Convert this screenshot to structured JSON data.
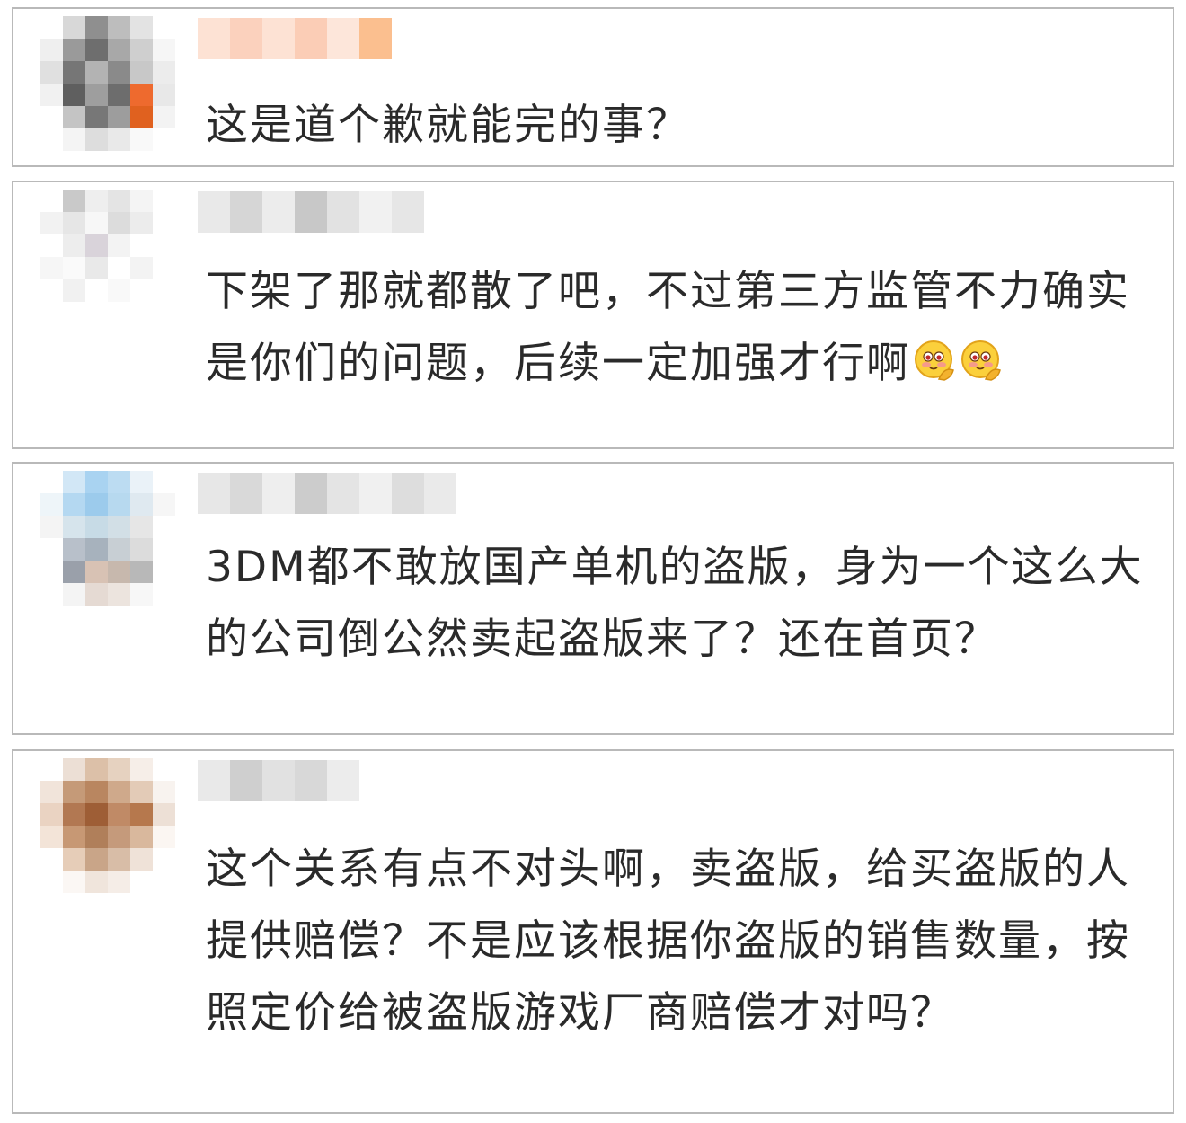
{
  "comments": [
    {
      "text": "这是道个歉就能完的事？",
      "avatar_colors": [
        "#ffffff",
        "#d8d8d8",
        "#8f8f8f",
        "#bdbdbd",
        "#e3e3e3",
        "#ffffff",
        "#efefef",
        "#9a9a9a",
        "#6e6e6e",
        "#a8a8a8",
        "#cfcfcf",
        "#f6f6f6",
        "#e0e0e0",
        "#767676",
        "#b3b3b3",
        "#8a8a8a",
        "#c8c8c8",
        "#ececec",
        "#f1f1f1",
        "#5f5f5f",
        "#9e9e9e",
        "#6d6d6d",
        "#ee6a2e",
        "#e8e8e8",
        "#ffffff",
        "#c4c4c4",
        "#777777",
        "#9d9d9d",
        "#e0611f",
        "#f3f3f3",
        "#ffffff",
        "#f4f4f4",
        "#dddddd",
        "#e9e9e9",
        "#f9f9f9",
        "#ffffff"
      ],
      "name_colors": [
        "#fde2d4",
        "#fbd1bd",
        "#fde2d4",
        "#fbcdb6",
        "#fde6da",
        "#fbbf8f"
      ]
    },
    {
      "text": "下架了那就都散了吧，不过第三方监管不力确实是你们的问题，后续一定加强才行啊",
      "emojis": [
        "hand-on-chin-blushing-emoji",
        "hand-on-chin-blushing-emoji"
      ],
      "avatar_colors": [
        "#ffffff",
        "#c9c9c9",
        "#eeeeee",
        "#e4e4e4",
        "#f4f4f4",
        "#ffffff",
        "#f2f2f2",
        "#e6e6e6",
        "#f7f7f7",
        "#dcdcdc",
        "#ececec",
        "#ffffff",
        "#ffffff",
        "#ededed",
        "#d9d3da",
        "#f3f3f3",
        "#ffffff",
        "#ffffff",
        "#f6f6f6",
        "#fafafa",
        "#e9e9e9",
        "#ffffff",
        "#f3f3f3",
        "#ffffff",
        "#ffffff",
        "#f1f1f1",
        "#ffffff",
        "#f9f9f9",
        "#ffffff",
        "#ffffff",
        "#ffffff",
        "#ffffff",
        "#ffffff",
        "#ffffff",
        "#ffffff",
        "#ffffff"
      ],
      "name_colors": [
        "#e9e9e9",
        "#d6d6d6",
        "#ececec",
        "#c8c8c8",
        "#e2e2e2",
        "#f1f1f1",
        "#e6e6e6"
      ]
    },
    {
      "text": "3DM都不敢放国产单机的盗版，身为一个这么大的公司倒公然卖起盗版来了？还在首页？",
      "avatar_colors": [
        "#ffffff",
        "#d2e7f6",
        "#a9d3f1",
        "#bcdcf2",
        "#eaf2f8",
        "#ffffff",
        "#eef5f9",
        "#b4d8f1",
        "#9ccbec",
        "#b7d9ef",
        "#dfe9f0",
        "#f6f6f6",
        "#f4f4f4",
        "#d6e4ec",
        "#c7dbe6",
        "#d2dfe6",
        "#e6e6e6",
        "#ffffff",
        "#ffffff",
        "#b8c0ca",
        "#a7b2bd",
        "#c8cfd4",
        "#dcdcdc",
        "#ffffff",
        "#ffffff",
        "#9aa0aa",
        "#d8c2b4",
        "#c7b8ad",
        "#b8b8b8",
        "#ffffff",
        "#ffffff",
        "#f4f4f4",
        "#e5dad3",
        "#ece4de",
        "#f7f7f7",
        "#ffffff"
      ],
      "name_colors": [
        "#e7e7e7",
        "#d9d9d9",
        "#eeeeee",
        "#cccccc",
        "#e4e4e4",
        "#f0f0f0",
        "#dddddd",
        "#eaeaea"
      ]
    },
    {
      "text": "这个关系有点不对头啊，卖盗版，给买盗版的人提供赔偿？不是应该根据你盗版的销售数量，按照定价给被盗版游戏厂商赔偿才对吗？",
      "avatar_colors": [
        "#ffffff",
        "#ecdfd5",
        "#dcc0a8",
        "#e6d2c0",
        "#f6eee8",
        "#ffffff",
        "#f1e4da",
        "#c59a78",
        "#b98660",
        "#cfa98b",
        "#e3cbb7",
        "#f8f3ef",
        "#ead3c2",
        "#b27852",
        "#9e5e36",
        "#c08a66",
        "#b6784d",
        "#ede0d6",
        "#f3e4d8",
        "#c79874",
        "#b07f5a",
        "#c59a7b",
        "#d9b89d",
        "#fbf6f2",
        "#ffffff",
        "#e6cdb8",
        "#c9a588",
        "#d8bda7",
        "#efe2d8",
        "#ffffff",
        "#ffffff",
        "#fbf7f4",
        "#f0e5dc",
        "#f5ede7",
        "#ffffff",
        "#ffffff"
      ],
      "name_colors": [
        "#e9e9e9",
        "#cfcfcf",
        "#e1e1e1",
        "#d8d8d8",
        "#ececec"
      ]
    }
  ]
}
